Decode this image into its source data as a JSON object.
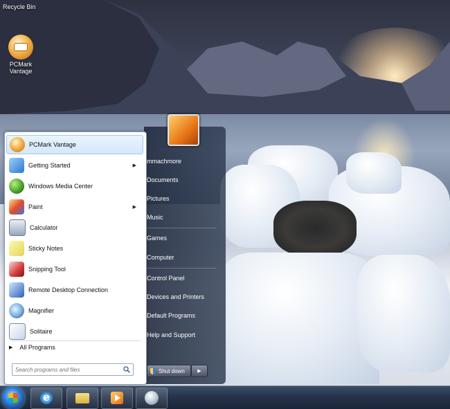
{
  "desktop": {
    "recycle_bin_label": "Recycle Bin",
    "pcmark_icon_label": "PCMark Vantage"
  },
  "start_menu": {
    "programs": [
      {
        "label": "PCMark Vantage",
        "icon": "pcmark-icon",
        "submenu": false,
        "highlighted": true
      },
      {
        "label": "Getting Started",
        "icon": "getting-started-icon",
        "submenu": true
      },
      {
        "label": "Windows Media Center",
        "icon": "media-center-icon",
        "submenu": false
      },
      {
        "label": "Paint",
        "icon": "paint-icon",
        "submenu": true
      },
      {
        "label": "Calculator",
        "icon": "calculator-icon",
        "submenu": false
      },
      {
        "label": "Sticky Notes",
        "icon": "sticky-notes-icon",
        "submenu": false
      },
      {
        "label": "Snipping Tool",
        "icon": "snipping-tool-icon",
        "submenu": false
      },
      {
        "label": "Remote Desktop Connection",
        "icon": "remote-desktop-icon",
        "submenu": false
      },
      {
        "label": "Magnifier",
        "icon": "magnifier-icon",
        "submenu": false
      },
      {
        "label": "Solitaire",
        "icon": "solitaire-icon",
        "submenu": false
      }
    ],
    "all_programs_label": "All Programs",
    "search_placeholder": "Search programs and files",
    "user_name": "mmachmore",
    "places": [
      "Documents",
      "Pictures",
      "Music",
      "Games",
      "Computer",
      "Control Panel",
      "Devices and Printers",
      "Default Programs",
      "Help and Support"
    ],
    "shutdown_label": "Shut down"
  },
  "taskbar": {
    "items": [
      "start-orb",
      "internet-explorer-icon",
      "folder-icon",
      "media-player-icon",
      "pcmark-taskbar-icon"
    ]
  }
}
